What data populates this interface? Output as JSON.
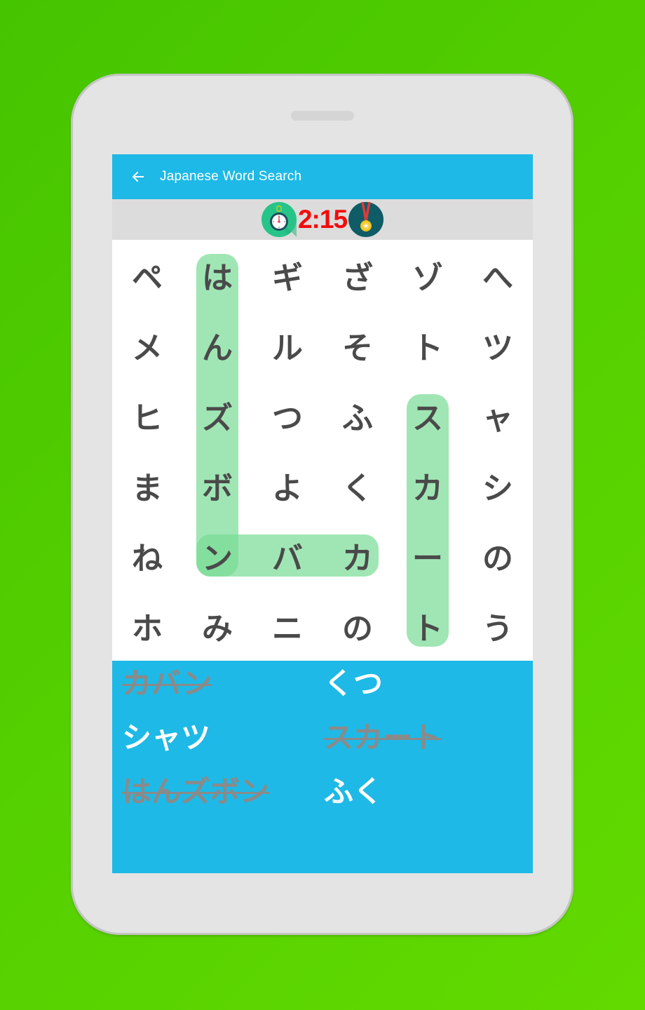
{
  "app": {
    "title": "Japanese Word Search",
    "back_icon": "arrow-left-icon"
  },
  "timer": {
    "icon": "stopwatch-icon",
    "value": "2:15",
    "badge_icon": "medal-icon"
  },
  "colors": {
    "background_green": "#55d000",
    "appbar_blue": "#1eb9e6",
    "timer_red": "#f20c0c",
    "highlight_green": "#9ee8b4",
    "letter_gray": "#4a4a4a",
    "found_word_gray": "#8a8a8a"
  },
  "grid": {
    "rows": [
      [
        "ペ",
        "は",
        "ギ",
        "ざ",
        "ゾ",
        "へ"
      ],
      [
        "メ",
        "ん",
        "ル",
        "そ",
        "ト",
        "ツ"
      ],
      [
        "ヒ",
        "ズ",
        "つ",
        "ふ",
        "ス",
        "ャ"
      ],
      [
        "ま",
        "ボ",
        "よ",
        "く",
        "カ",
        "シ"
      ],
      [
        "ね",
        "ン",
        "バ",
        "カ",
        "ー",
        "の"
      ],
      [
        "ホ",
        "み",
        "ニ",
        "の",
        "ト",
        "う"
      ]
    ],
    "found_highlights": [
      {
        "word": "はんズボン",
        "from": [
          0,
          1
        ],
        "to": [
          4,
          1
        ]
      },
      {
        "word": "カバン",
        "from": [
          4,
          3
        ],
        "to": [
          4,
          1
        ]
      },
      {
        "word": "スカート",
        "from": [
          2,
          4
        ],
        "to": [
          5,
          4
        ]
      }
    ]
  },
  "word_list": [
    {
      "text": "カバン",
      "found": true
    },
    {
      "text": "くつ",
      "found": false
    },
    {
      "text": "シャツ",
      "found": false
    },
    {
      "text": "スカート",
      "found": true
    },
    {
      "text": "はんズボン",
      "found": true
    },
    {
      "text": "ふく",
      "found": false
    }
  ]
}
